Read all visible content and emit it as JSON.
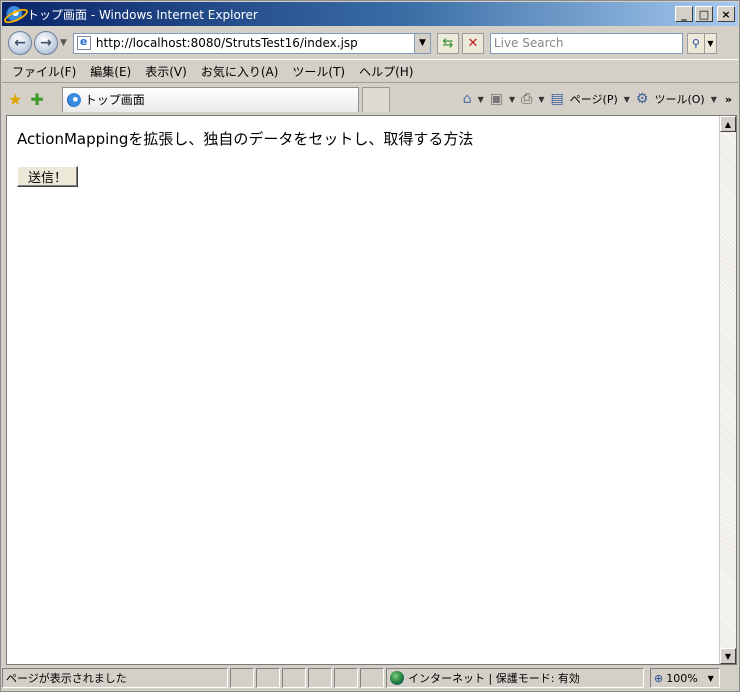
{
  "window": {
    "title": "トップ画面 - Windows Internet Explorer",
    "controls": {
      "minimize": "_",
      "maximize": "□",
      "close": "×"
    }
  },
  "addressbar": {
    "url": "http://localhost:8080/StrutsTest16/index.jsp",
    "search_placeholder": "Live Search"
  },
  "menubar": {
    "items": [
      "ファイル(F)",
      "編集(E)",
      "表示(V)",
      "お気に入り(A)",
      "ツール(T)",
      "ヘルプ(H)"
    ]
  },
  "tabs": {
    "active_label": "トップ画面"
  },
  "commandbar": {
    "page_label": "ページ(P)",
    "tools_label": "ツール(O)"
  },
  "page": {
    "heading": "ActionMappingを拡張し、独自のデータをセットし、取得する方法",
    "submit_label": "送信！"
  },
  "statusbar": {
    "message": "ページが表示されました",
    "zone": "インターネット | 保護モード: 有効",
    "zoom": "100%"
  },
  "icons": {
    "back": "back-arrow-icon",
    "forward": "forward-arrow-icon",
    "refresh": "refresh-icon",
    "stop": "stop-icon",
    "search": "search-icon",
    "favorites": "favorites-star-icon",
    "add_favorite": "add-favorite-icon",
    "home": "home-icon",
    "feeds": "feeds-icon",
    "print": "print-icon",
    "page": "page-icon",
    "tools": "gear-icon",
    "zone": "globe-icon",
    "zoom": "zoom-icon"
  },
  "colors": {
    "titlebar_start": "#0a246a",
    "titlebar_end": "#a6caf0",
    "chrome": "#d4d0c8"
  }
}
